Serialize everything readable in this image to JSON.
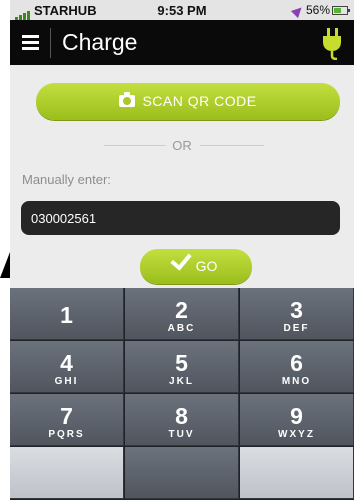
{
  "status_bar": {
    "carrier": "STARHUB",
    "time": "9:53 PM",
    "battery": "56%"
  },
  "nav": {
    "title": "Charge"
  },
  "scan": {
    "label": "SCAN QR CODE"
  },
  "divider": {
    "label": "OR"
  },
  "manual": {
    "label": "Manually enter:",
    "value": "030002561"
  },
  "go": {
    "label": "GO"
  },
  "keypad": {
    "keys": [
      {
        "num": "1",
        "letters": ""
      },
      {
        "num": "2",
        "letters": "ABC"
      },
      {
        "num": "3",
        "letters": "DEF"
      },
      {
        "num": "4",
        "letters": "GHI"
      },
      {
        "num": "5",
        "letters": "JKL"
      },
      {
        "num": "6",
        "letters": "MNO"
      },
      {
        "num": "7",
        "letters": "PQRS"
      },
      {
        "num": "8",
        "letters": "TUV"
      },
      {
        "num": "9",
        "letters": "WXYZ"
      }
    ]
  },
  "colors": {
    "accent": "#a9c92a",
    "nav_background": "#0a0a0a",
    "input_background": "#262626"
  },
  "icons": {
    "menu": "hamburger-icon",
    "plug": "plug-icon",
    "camera": "camera-icon",
    "check": "check-icon"
  }
}
